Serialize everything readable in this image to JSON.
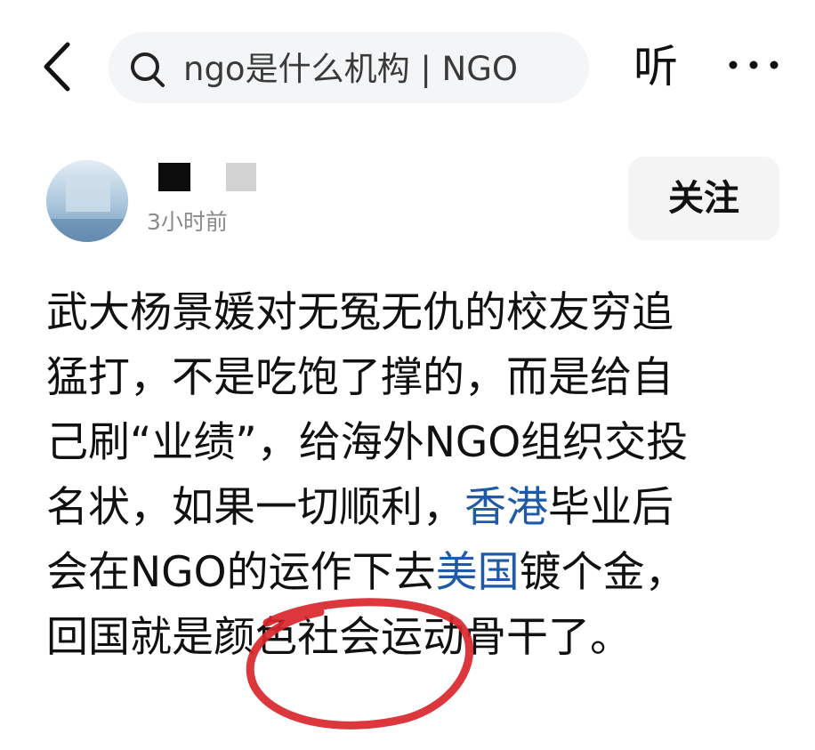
{
  "header": {
    "search_text": "ngo是什么机构 | NGO",
    "listen_label": "听",
    "back_icon": "chevron-left-icon",
    "more_icon": "more-dots-icon"
  },
  "author": {
    "time": "3小时前",
    "follow_label": "关注"
  },
  "post": {
    "line1": "武大杨景媛对无冤无仇的校友穷追",
    "line2": "猛打，不是吃饱了撑的，而是给自",
    "line3": "己刷“业绩”，给海外NGO组织交投",
    "line4_a": "名状，如果一切顺利，",
    "line4_link": "香港",
    "line4_b": "毕业后",
    "line5_a": "会在NGO的运作下去",
    "line5_link": "美国",
    "line5_b": "镀个金，",
    "line6": "回国就是颜色社会运动骨干了。"
  },
  "colors": {
    "link": "#1e5aa8",
    "annotation": "#d9262b",
    "search_bg": "#f4f5f7"
  }
}
